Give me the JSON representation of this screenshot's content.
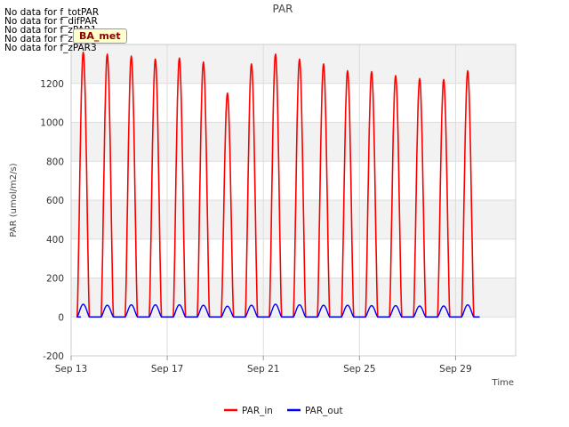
{
  "chart_data": {
    "type": "line",
    "title": "PAR",
    "ylabel": "PAR (umol/m2/s)",
    "xlabel": "Time",
    "ylim": [
      -200,
      1400
    ],
    "yticks": [
      -200,
      0,
      200,
      400,
      600,
      800,
      1000,
      1200
    ],
    "xlim": [
      "2023-09-13",
      "2023-10-01T12:00"
    ],
    "xtick_labels": [
      "Sep 13",
      "Sep 17",
      "Sep 21",
      "Sep 25",
      "Sep 29"
    ],
    "xtick_days": [
      0,
      4,
      8,
      12,
      16
    ],
    "grid": true,
    "legend_position": "bottom-center",
    "series": [
      {
        "name": "PAR_in",
        "color": "#ff0000",
        "daily_peak_values": [
          1360,
          1350,
          1340,
          1325,
          1330,
          1310,
          1150,
          1300,
          1350,
          1325,
          1300,
          1265,
          1260,
          1240,
          1225,
          1220,
          1265
        ]
      },
      {
        "name": "PAR_out",
        "color": "#0000ff",
        "daily_peak_values": [
          65,
          60,
          62,
          62,
          62,
          60,
          55,
          60,
          65,
          62,
          60,
          60,
          58,
          58,
          56,
          56,
          62
        ]
      }
    ]
  },
  "messages": [
    "No data for f_totPAR",
    "No data for f_difPAR",
    "No data for f_zPAR1",
    "No data for f_zPAR2",
    "No data for f_zPAR3"
  ],
  "badge": "BA_met"
}
